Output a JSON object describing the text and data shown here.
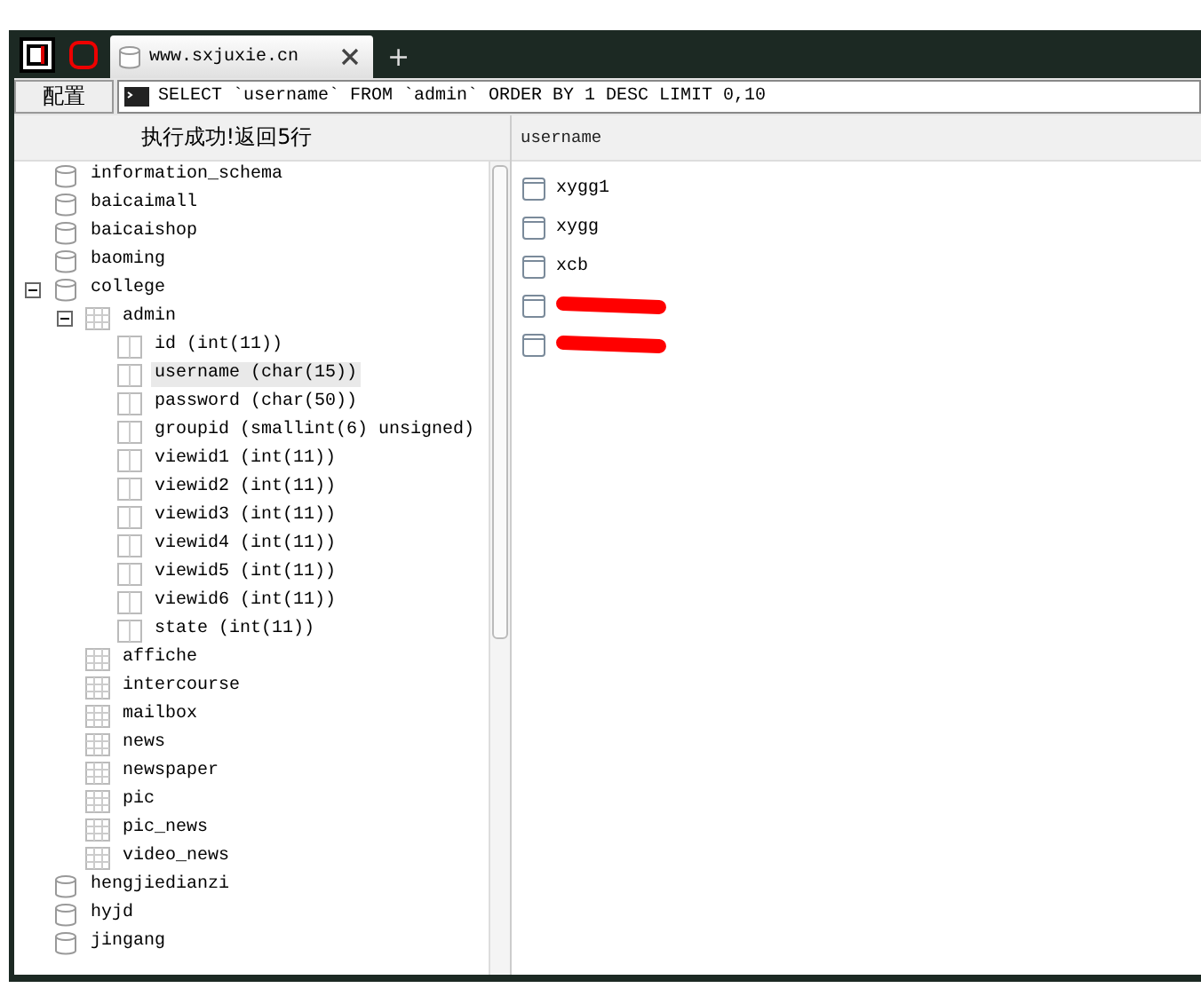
{
  "tabs": [
    {
      "label": "www.sxjuxie.cn",
      "selected": true
    }
  ],
  "new_tab": "+",
  "toolbar": {
    "config_button": "配置",
    "query": "SELECT `username` FROM `admin` ORDER BY 1 DESC LIMIT 0,10"
  },
  "status": "执行成功!返回5行",
  "tree": [
    {
      "kind": "database",
      "label": "information_schema",
      "selected": false
    },
    {
      "kind": "database",
      "label": "baicaimall",
      "selected": false
    },
    {
      "kind": "database",
      "label": "baicaishop",
      "selected": false
    },
    {
      "kind": "database",
      "label": "baoming",
      "selected": false
    },
    {
      "kind": "database",
      "label": "college",
      "selected": false,
      "expanded": true,
      "children": [
        {
          "kind": "table",
          "label": "admin",
          "selected": false,
          "expanded": true,
          "children": [
            {
              "kind": "column",
              "label": "id (int(11))",
              "selected": false
            },
            {
              "kind": "column",
              "label": "username (char(15))",
              "selected": true
            },
            {
              "kind": "column",
              "label": "password (char(50))",
              "selected": false
            },
            {
              "kind": "column",
              "label": "groupid (smallint(6) unsigned)",
              "selected": false
            },
            {
              "kind": "column",
              "label": "viewid1 (int(11))",
              "selected": false
            },
            {
              "kind": "column",
              "label": "viewid2 (int(11))",
              "selected": false
            },
            {
              "kind": "column",
              "label": "viewid3 (int(11))",
              "selected": false
            },
            {
              "kind": "column",
              "label": "viewid4 (int(11))",
              "selected": false
            },
            {
              "kind": "column",
              "label": "viewid5 (int(11))",
              "selected": false
            },
            {
              "kind": "column",
              "label": "viewid6 (int(11))",
              "selected": false
            },
            {
              "kind": "column",
              "label": "state (int(11))",
              "selected": false
            }
          ]
        },
        {
          "kind": "table",
          "label": "affiche",
          "selected": false
        },
        {
          "kind": "table",
          "label": "intercourse",
          "selected": false
        },
        {
          "kind": "table",
          "label": "mailbox",
          "selected": false
        },
        {
          "kind": "table",
          "label": "news",
          "selected": false
        },
        {
          "kind": "table",
          "label": "newspaper",
          "selected": false
        },
        {
          "kind": "table",
          "label": "pic",
          "selected": false
        },
        {
          "kind": "table",
          "label": "pic_news",
          "selected": false
        },
        {
          "kind": "table",
          "label": "video_news",
          "selected": false
        }
      ]
    },
    {
      "kind": "database",
      "label": "hengjiedianzi",
      "selected": false
    },
    {
      "kind": "database",
      "label": "hyjd",
      "selected": false
    },
    {
      "kind": "database",
      "label": "jingang",
      "selected": false
    }
  ],
  "results": {
    "columns": [
      "username"
    ],
    "rows": [
      {
        "value": "xygg1",
        "redacted": false
      },
      {
        "value": "xygg",
        "redacted": false
      },
      {
        "value": "xcb",
        "redacted": false
      },
      {
        "redacted": true
      },
      {
        "redacted": true
      }
    ]
  }
}
